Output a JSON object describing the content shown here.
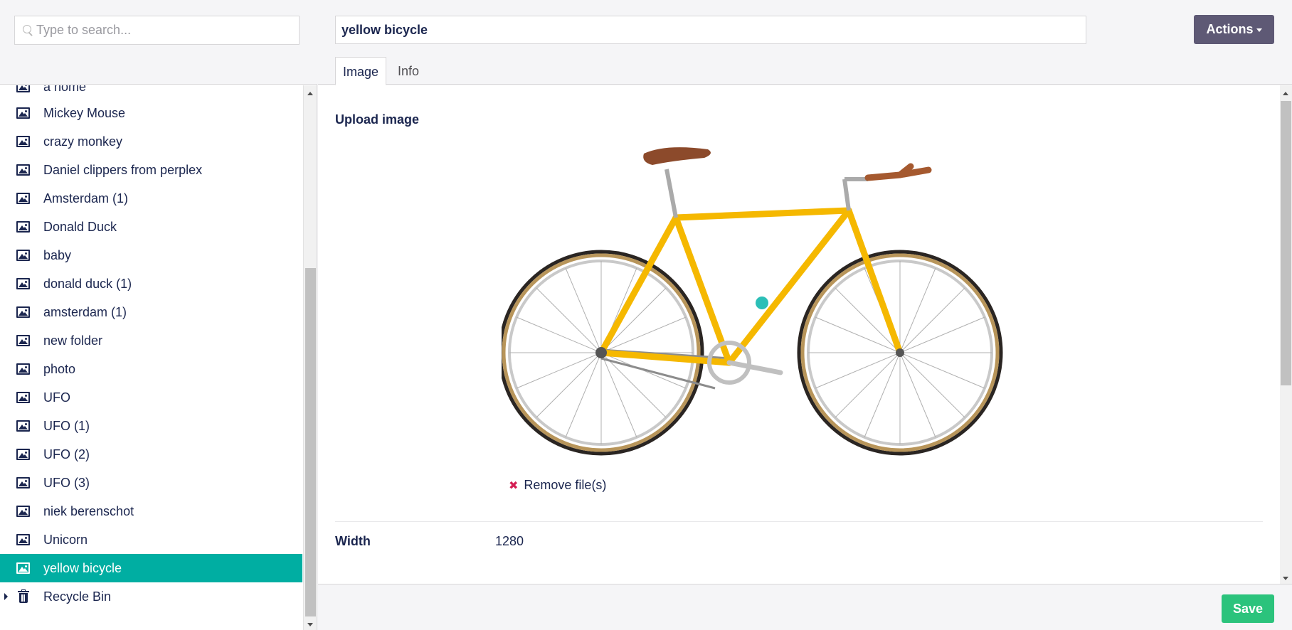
{
  "search": {
    "placeholder": "Type to search..."
  },
  "tree": {
    "items": [
      {
        "label": "a home"
      },
      {
        "label": "Mickey Mouse"
      },
      {
        "label": "crazy monkey"
      },
      {
        "label": "Daniel clippers from perplex"
      },
      {
        "label": "Amsterdam (1)"
      },
      {
        "label": "Donald Duck"
      },
      {
        "label": "baby"
      },
      {
        "label": "donald duck (1)"
      },
      {
        "label": "amsterdam (1)"
      },
      {
        "label": "new folder"
      },
      {
        "label": "photo"
      },
      {
        "label": "UFO"
      },
      {
        "label": "UFO (1)"
      },
      {
        "label": "UFO (2)"
      },
      {
        "label": "UFO (3)"
      },
      {
        "label": "niek berenschot"
      },
      {
        "label": "Unicorn"
      },
      {
        "label": "yellow bicycle",
        "selected": true
      }
    ],
    "recycle_bin": "Recycle Bin"
  },
  "editor": {
    "name": "yellow bicycle",
    "actions_label": "Actions",
    "tabs": [
      {
        "label": "Image"
      },
      {
        "label": "Info"
      }
    ],
    "upload_label": "Upload image",
    "remove_files": "Remove file(s)",
    "remove_icon": "✖",
    "width_label": "Width",
    "width_value": "1280"
  },
  "footer": {
    "save_label": "Save"
  },
  "colors": {
    "accent_selected": "#00aea2",
    "actions_button": "#5e5975",
    "save_button": "#2bc37c",
    "text": "#1b264f"
  }
}
